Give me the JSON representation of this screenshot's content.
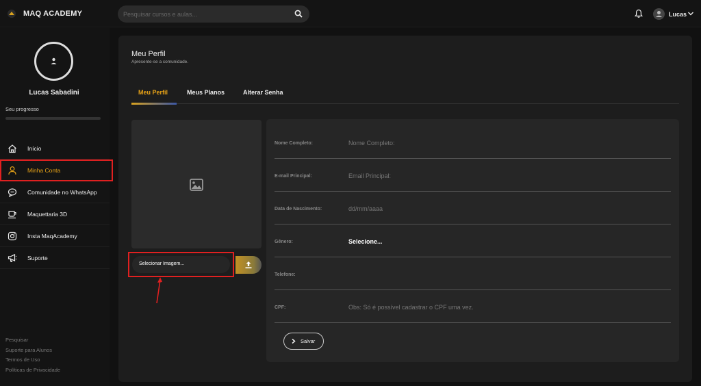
{
  "topbar": {
    "brand": "MAQ ACADEMY",
    "search_placeholder": "Pesquisar cursos e aulas...",
    "user_name": "Lucas"
  },
  "sidebar": {
    "profile_name": "Lucas Sabadini",
    "progress_label": "Seu progresso",
    "progress_percent": 0,
    "items": [
      {
        "label": "Início",
        "icon": "home-icon"
      },
      {
        "label": "Minha Conta",
        "icon": "user-icon",
        "active": true
      },
      {
        "label": "Comunidade no WhatsApp",
        "icon": "whatsapp-icon"
      },
      {
        "label": "Maquettaria 3D",
        "icon": "coffee-cup-icon"
      },
      {
        "label": "Insta MaqAcademy",
        "icon": "instagram-icon"
      },
      {
        "label": "Suporte",
        "icon": "megaphone-icon"
      }
    ],
    "footer_links": [
      "Pesquisar",
      "Suporte para Alunos",
      "Termos de Uso",
      "Políticas de Privacidade"
    ]
  },
  "main": {
    "title": "Meu Perfil",
    "subtitle": "Apresente-se a comunidade.",
    "tabs": [
      {
        "label": "Meu Perfil",
        "active": true
      },
      {
        "label": "Meus Planos"
      },
      {
        "label": "Alterar Senha"
      }
    ],
    "select_image_label": "Selecionar Imagem...",
    "fields": [
      {
        "label": "Nome Completo:",
        "placeholder": "Nome Completo:"
      },
      {
        "label": "E-mail Principal:",
        "placeholder": "Email Principal:"
      },
      {
        "label": "Data de Nascimento:",
        "placeholder": "dd/mm/aaaa"
      },
      {
        "label": "Gênero:",
        "value": "Selecione..."
      },
      {
        "label": "Telefone:",
        "placeholder": ""
      },
      {
        "label": "CPF:",
        "placeholder": "Obs: Só é possível cadastrar o CPF uma vez."
      }
    ],
    "save_label": "Salvar"
  },
  "colors": {
    "accent": "#e8a317",
    "highlight_border": "#e02020",
    "tab_gradient_end": "#3b57a6"
  }
}
